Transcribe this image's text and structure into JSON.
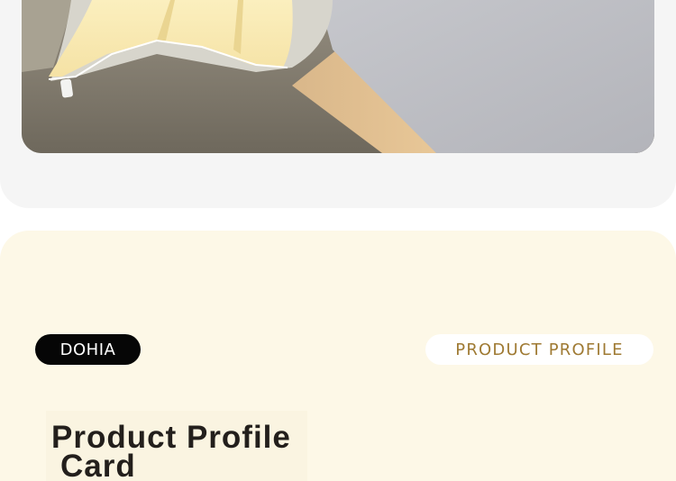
{
  "header_section": {
    "image_alt": "Bed with pale yellow bedding on wooden frame over carpet"
  },
  "profile_section": {
    "brand_label": "DOHIA",
    "profile_label": "PRODUCT PROFILE",
    "card_title_line1": "Product Profile",
    "card_title_line2": "Card"
  },
  "colors": {
    "top_background": "#f5f5f5",
    "bottom_background": "#fdf8e7",
    "brand_badge": "#060606",
    "profile_text": "#9f7a33",
    "title_text": "#231f1c"
  }
}
